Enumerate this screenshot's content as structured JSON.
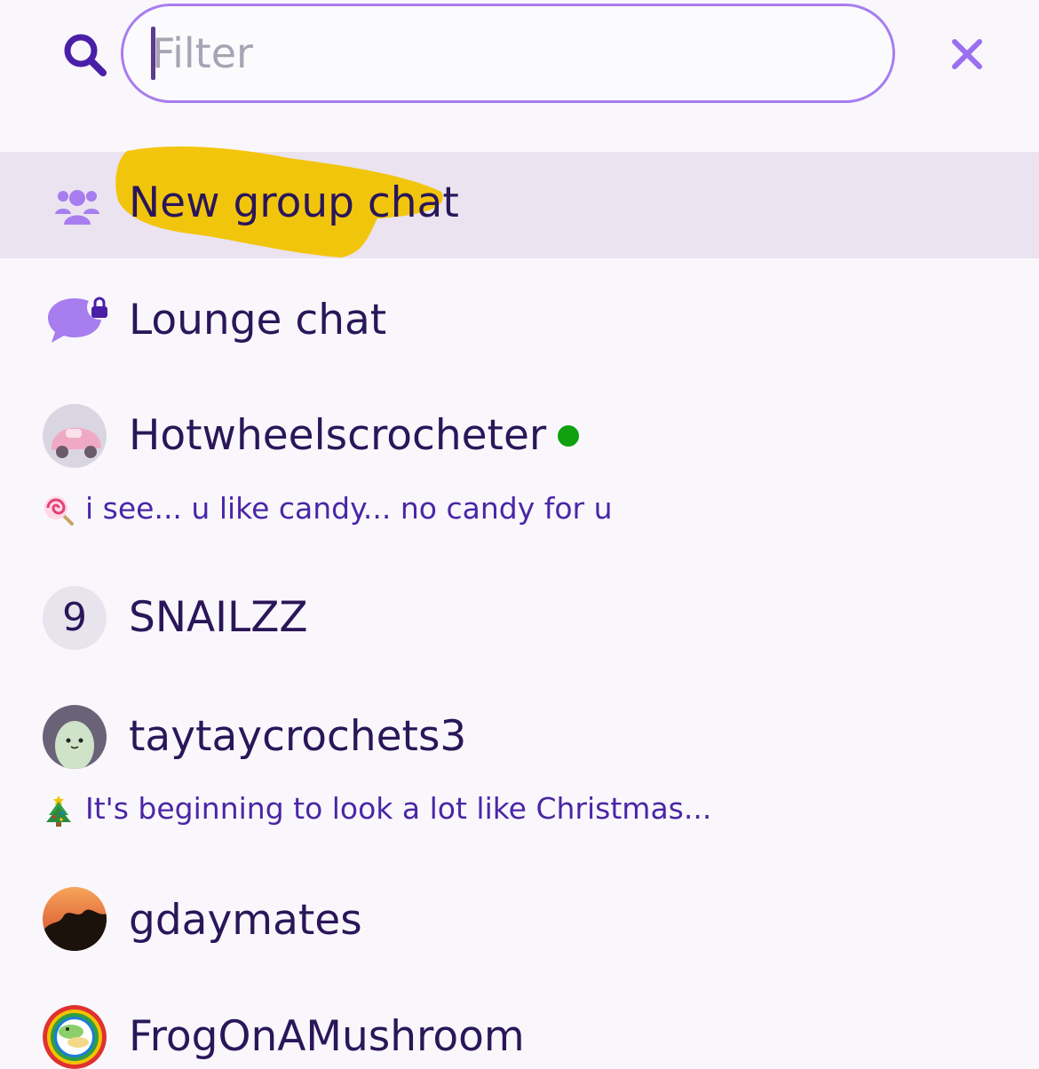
{
  "search": {
    "placeholder": "Filter",
    "value": "",
    "search_icon": "search-icon",
    "close_icon": "close-icon"
  },
  "actions": [
    {
      "label": "New group chat",
      "icon": "group-icon",
      "highlighted": true,
      "highlight_color": "#f2c300"
    },
    {
      "label": "Lounge chat",
      "icon": "chat-bubble-lock-icon"
    }
  ],
  "contacts": [
    {
      "name": "Hotwheelscrocheter",
      "online": true,
      "status_emoji": "lollipop",
      "status_text": "i see... u like candy... no candy for u"
    },
    {
      "name": "SNAILZZ",
      "badge": "9"
    },
    {
      "name": "taytaycrochets3",
      "status_emoji": "christmas-tree",
      "status_text": "It's beginning to look a lot like Christmas..."
    },
    {
      "name": "gdaymates"
    },
    {
      "name": "FrogOnAMushroom"
    }
  ],
  "colors": {
    "background": "#f9f7fc",
    "accent": "#a77df0",
    "text": "#2a1659",
    "status_text": "#4a26a6",
    "selected_row": "#ebe3f0",
    "online": "#10a010"
  }
}
